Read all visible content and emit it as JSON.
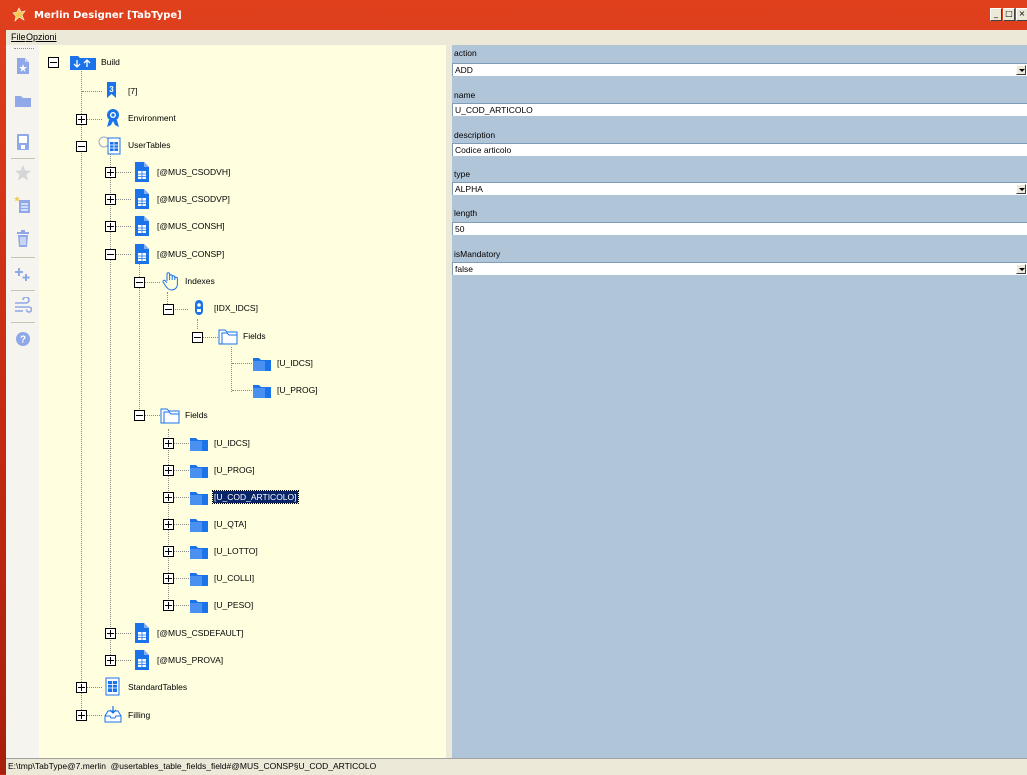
{
  "window": {
    "title": "Merlin Designer [TabType]",
    "buttons": [
      "_",
      "□",
      "×"
    ]
  },
  "menu": {
    "items": [
      "File",
      "Opzioni"
    ]
  },
  "toolbar": {
    "icons": [
      "new-document-icon",
      "open-folder-icon",
      "save-disk-icon",
      "favorite-star-icon",
      "add-list-icon",
      "delete-trash-icon",
      "add-item-icon",
      "wind-icon",
      "help-icon"
    ]
  },
  "tree": {
    "root": "Build",
    "version": "[7]",
    "environment": "Environment",
    "user_tables": "UserTables",
    "mus_csodvh": "[@MUS_CSODVH]",
    "mus_csodvp": "[@MUS_CSODVP]",
    "mus_consh": "[@MUS_CONSH]",
    "mus_consp": "[@MUS_CONSP]",
    "indexes": "Indexes",
    "idx_idcs": "[IDX_IDCS]",
    "idx_fields": "Fields",
    "idx_field_1": "[U_IDCS]",
    "idx_field_2": "[U_PROG]",
    "fields": "Fields",
    "field_u_idcs": "[U_IDCS]",
    "field_u_prog": "[U_PROG]",
    "field_u_cod_articolo": "[U_COD_ARTICOLO]",
    "field_u_qta": "[U_QTA]",
    "field_u_lotto": "[U_LOTTO]",
    "field_u_colli": "[U_COLLI]",
    "field_u_peso": "[U_PESO]",
    "mus_csdefault": "[@MUS_CSDEFAULT]",
    "mus_prova": "[@MUS_PROVA]",
    "standard_tables": "StandardTables",
    "filling": "Filling"
  },
  "properties": {
    "action_label": "action",
    "action_value": "ADD",
    "name_label": "name",
    "name_value": "U_COD_ARTICOLO",
    "description_label": "description",
    "description_value": "Codice articolo",
    "type_label": "type",
    "type_value": "ALPHA",
    "length_label": "length",
    "length_value": "50",
    "mandatory_label": "isMandatory",
    "mandatory_value": "false"
  },
  "status": {
    "text": "E:\\tmp\\TabType@7.merlin  @usertables_table_fields_field#@MUS_CONSP§U_COD_ARTICOLO"
  },
  "colors": {
    "title_bar": "#d83a18",
    "tree_background": "#ffffe0",
    "properties_background": "#b1c5d8",
    "selection": "#0a246a",
    "icon_blue": "#1a73e8"
  }
}
